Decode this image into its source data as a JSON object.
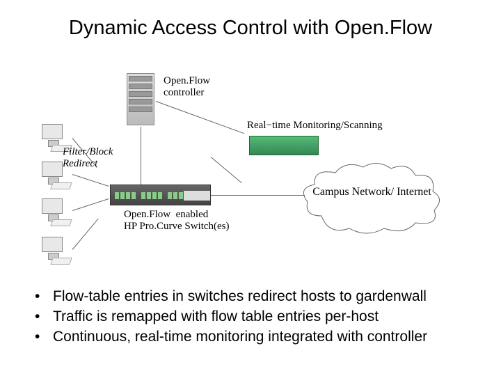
{
  "title": "Dynamic Access Control with Open.Flow",
  "diagram": {
    "controller_label": "Open.Flow\ncontroller",
    "filter_label": "Filter/Block\nRedirect",
    "switch_label": "Open.Flow  enabled\nHP Pro.Curve Switch(es)",
    "monitoring_label": "Real−time Monitoring/Scanning",
    "cloud_label": "Campus Network/\nInternet"
  },
  "bullets": [
    "Flow-table entries in switches redirect hosts to gardenwall",
    "Traffic is remapped with flow table entries per-host",
    "Continuous, real-time monitoring integrated with controller"
  ]
}
